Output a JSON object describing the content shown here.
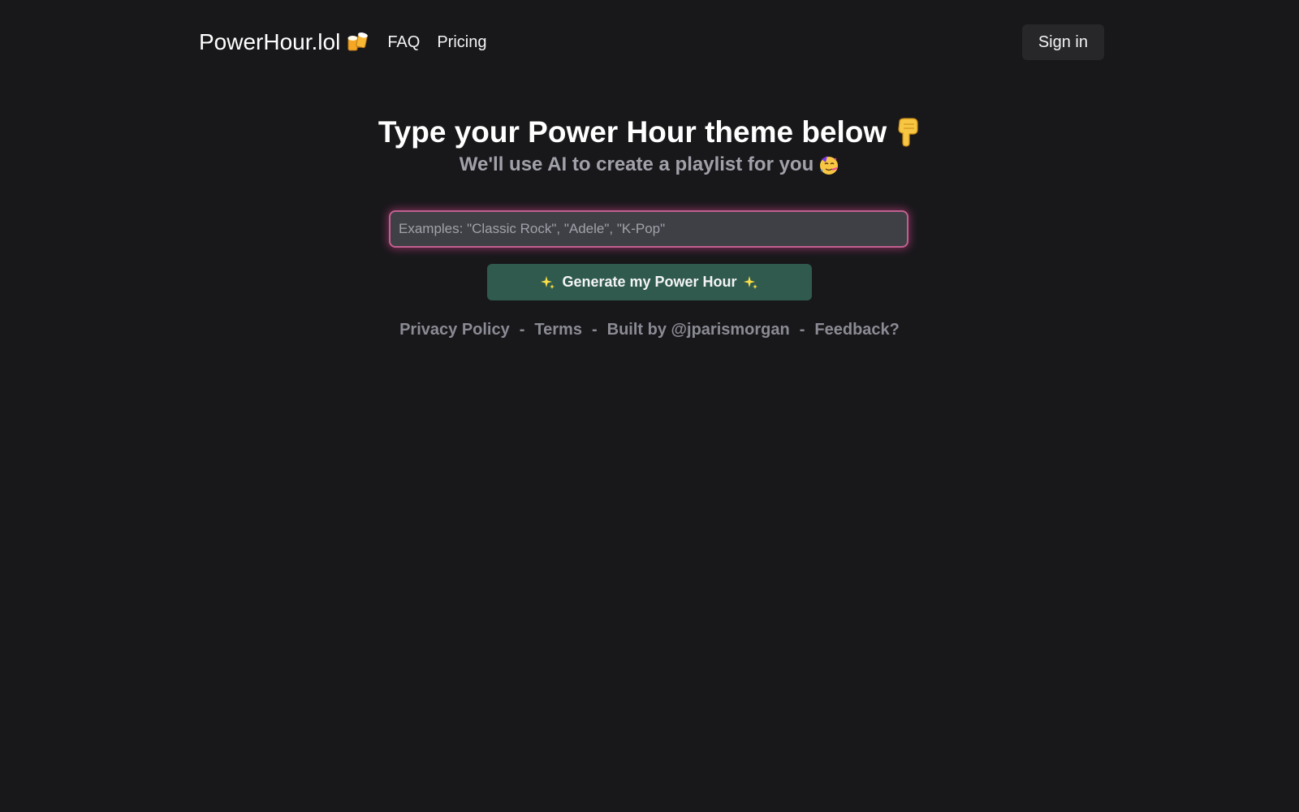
{
  "nav": {
    "brand": "PowerHour.lol",
    "brand_icon": "beer-mugs-icon",
    "links": [
      {
        "label": "FAQ"
      },
      {
        "label": "Pricing"
      }
    ],
    "sign_in_label": "Sign in"
  },
  "hero": {
    "headline": "Type your Power Hour theme below",
    "headline_icon": "pointing-down-icon",
    "subline": "We'll use AI to create a playlist for you",
    "subline_icon": "party-face-icon"
  },
  "form": {
    "theme_placeholder": "Examples: \"Classic Rock\", \"Adele\", \"K-Pop\"",
    "theme_value": "",
    "generate_label": "Generate my Power Hour",
    "generate_icon": "sparkles-icon"
  },
  "footer": {
    "links": [
      {
        "label": "Privacy Policy"
      },
      {
        "label": "Terms"
      },
      {
        "label": "Built by @jparismorgan"
      },
      {
        "label": "Feedback?"
      }
    ],
    "separator": "-"
  },
  "colors": {
    "background": "#18181b",
    "input_glow": "#ec4899",
    "generate_button": "#2f5a4d",
    "muted_text": "#a1a1aa"
  }
}
